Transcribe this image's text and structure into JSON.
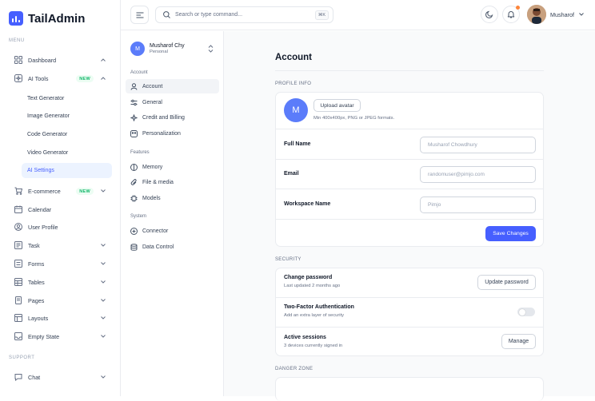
{
  "app": {
    "name": "TailAdmin"
  },
  "sidebar": {
    "menu_label": "MENU",
    "support_label": "SUPPORT",
    "items": [
      {
        "label": "Dashboard",
        "icon": "grid-icon"
      },
      {
        "label": "AI Tools",
        "icon": "sparkle-icon",
        "badge": "NEW"
      },
      {
        "label": "E-commerce",
        "icon": "cart-icon",
        "badge": "NEW"
      },
      {
        "label": "Calendar",
        "icon": "calendar-icon"
      },
      {
        "label": "User Profile",
        "icon": "user-circle-icon"
      },
      {
        "label": "Task",
        "icon": "task-icon"
      },
      {
        "label": "Forms",
        "icon": "forms-icon"
      },
      {
        "label": "Tables",
        "icon": "table-icon"
      },
      {
        "label": "Pages",
        "icon": "pages-icon"
      },
      {
        "label": "Layouts",
        "icon": "layouts-icon"
      },
      {
        "label": "Empty State",
        "icon": "empty-state-icon"
      },
      {
        "label": "Chat",
        "icon": "chat-icon"
      }
    ],
    "ai_sub": [
      "Text Generator",
      "Image Generator",
      "Code Generator",
      "Video Generator",
      "AI Settings"
    ]
  },
  "header": {
    "search_placeholder": "Search or type command...",
    "shortcut": "⌘K",
    "user_name": "Musharof"
  },
  "settings_nav": {
    "workspace_name": "Musharof Chy",
    "workspace_plan": "Personal",
    "workspace_initial": "M",
    "account_group": "Account",
    "features_group": "Features",
    "system_group": "System",
    "account_items": [
      "Account",
      "General",
      "Credit and Billing",
      "Personalization"
    ],
    "feature_items": [
      "Memory",
      "File & media",
      "Models"
    ],
    "system_items": [
      "Connector",
      "Data Control"
    ]
  },
  "account": {
    "title": "Account",
    "profile_label": "PROFILE INFO",
    "avatar_initial": "M",
    "upload_label": "Upload avatar",
    "upload_hint": "Min 400x400px, PNG or JPEG formats.",
    "full_name_label": "Full Name",
    "full_name_value": "Musharof Chowdhury",
    "email_label": "Email",
    "email_value": "randomuser@pimjo.com",
    "workspace_label": "Workspace Name",
    "workspace_value": "Pimjo",
    "save_label": "Save Changes",
    "security_label": "SECURITY",
    "change_pw_title": "Change password",
    "change_pw_desc": "Last updated 2 months ago",
    "update_pw_label": "Update password",
    "twofa_title": "Two-Factor Authentication",
    "twofa_desc": "Add an extra layer of security",
    "sessions_title": "Active sessions",
    "sessions_desc": "3 devices currently signed in",
    "manage_label": "Manage",
    "danger_label": "DANGER ZONE"
  },
  "colors": {
    "accent": "#465fff",
    "badge_green": "#12b76a"
  }
}
